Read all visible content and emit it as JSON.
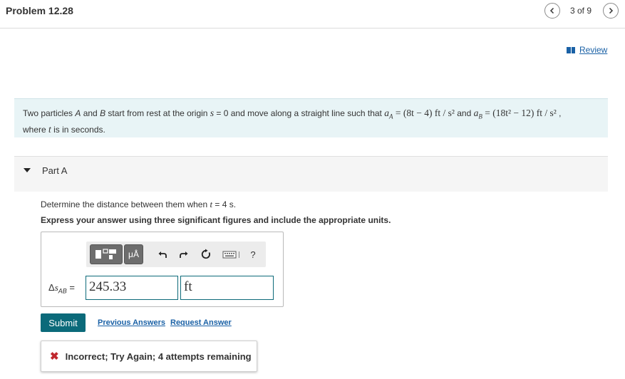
{
  "header": {
    "title": "Problem 12.28",
    "pager": "3 of 9",
    "prev_icon": "chevron-left-icon",
    "next_icon": "chevron-right-icon"
  },
  "review": {
    "label": "Review",
    "icon": "book-icon"
  },
  "prompt": {
    "text_1": "Two particles ",
    "A": "A",
    "text_2": " and ",
    "B": "B",
    "text_3": " start from rest at the origin ",
    "s": "s",
    "text_4": " = 0 and move along a straight line such that ",
    "aA_expr": "a",
    "aA_sub": "A",
    "aA_rhs": " = (8t − 4) ft / s²",
    "text_5": " and ",
    "aB_expr": "a",
    "aB_sub": "B",
    "aB_rhs": " = (18t² − 12) ft / s²",
    "text_6": " ,",
    "text_7": "where ",
    "t": "t",
    "text_8": " is in seconds."
  },
  "part": {
    "label": "Part A",
    "question_1": "Determine the distance between them when ",
    "question_t": "t",
    "question_2": " = 4 s.",
    "instruction": "Express your answer using three significant figures and include the appropriate units."
  },
  "answer": {
    "var_delta": "Δ",
    "var_s": "s",
    "var_sub": "AB",
    "var_eq": " =",
    "value": "245.33",
    "units": "ft",
    "toolbar": {
      "units_label": "μÅ",
      "help_label": "?",
      "icons": [
        "templates-icon",
        "units-icon",
        "undo-icon",
        "redo-icon",
        "reset-icon",
        "keyboard-icon",
        "help-icon"
      ]
    }
  },
  "actions": {
    "submit": "Submit",
    "previous_answers": "Previous Answers",
    "request_answer": "Request Answer"
  },
  "feedback": {
    "icon": "x-icon",
    "message": "Incorrect; Try Again; 4 attempts remaining"
  },
  "colors": {
    "accent": "#0b6a7a",
    "link": "#1a61a6",
    "prompt_bg": "#e8f4f6",
    "error": "#c0282e"
  }
}
